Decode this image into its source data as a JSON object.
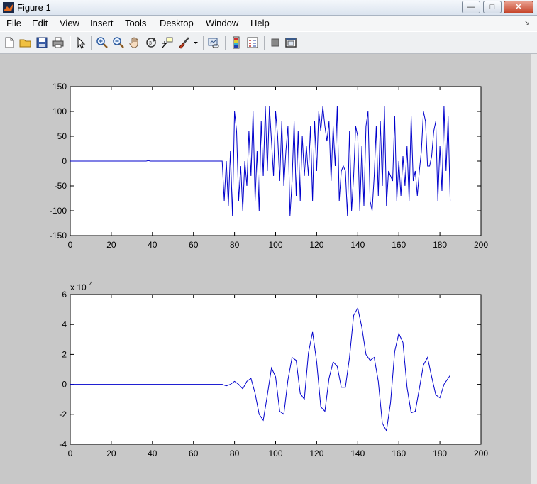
{
  "window": {
    "title": "Figure 1",
    "controls": [
      "minimize",
      "maximize",
      "close"
    ]
  },
  "menu": {
    "items": [
      "File",
      "Edit",
      "View",
      "Insert",
      "Tools",
      "Desktop",
      "Window",
      "Help"
    ]
  },
  "toolbar": {
    "icons": [
      "new-figure-icon",
      "open-file-icon",
      "save-icon",
      "print-icon",
      "pointer-icon",
      "zoom-in-icon",
      "zoom-out-icon",
      "pan-hand-icon",
      "rotate-3d-icon",
      "data-cursor-icon",
      "brush-icon",
      "brush-dropdown-icon",
      "link-plot-icon",
      "colorbar-icon",
      "legend-icon",
      "hide-plot-tools-icon",
      "show-plot-tools-icon"
    ]
  },
  "colors": {
    "line": "#0000cc",
    "axes_bg": "#ffffff",
    "figure_bg": "#c8c8c8"
  },
  "chart_data": [
    {
      "type": "line",
      "title": "",
      "xlabel": "",
      "ylabel": "",
      "xlim": [
        0,
        200
      ],
      "ylim": [
        -150,
        150
      ],
      "xticks": [
        0,
        20,
        40,
        60,
        80,
        100,
        120,
        140,
        160,
        180,
        200
      ],
      "yticks": [
        -150,
        -100,
        -50,
        0,
        50,
        100,
        150
      ],
      "grid": false,
      "series": [
        {
          "x": [
            0,
            10,
            20,
            30,
            37,
            38,
            39,
            40,
            50,
            60,
            70,
            74,
            75,
            76,
            77,
            78,
            79,
            80,
            81,
            82,
            83,
            84,
            85,
            86,
            87,
            88,
            89,
            90,
            91,
            92,
            93,
            94,
            95,
            96,
            97,
            98,
            99,
            100,
            101,
            102,
            103,
            104,
            105,
            106,
            107,
            108,
            109,
            110,
            111,
            112,
            113,
            114,
            115,
            116,
            117,
            118,
            119,
            120,
            121,
            122,
            123,
            124,
            125,
            126,
            127,
            128,
            129,
            130,
            131,
            132,
            133,
            134,
            135,
            136,
            137,
            138,
            139,
            140,
            141,
            142,
            143,
            144,
            145,
            146,
            147,
            148,
            149,
            150,
            151,
            152,
            153,
            154,
            155,
            156,
            157,
            158,
            159,
            160,
            161,
            162,
            163,
            164,
            165,
            166,
            167,
            168,
            169,
            170,
            171,
            172,
            173,
            174,
            175,
            176,
            177,
            178,
            179,
            180,
            181,
            182,
            183,
            184,
            185
          ],
          "y": [
            0,
            0,
            0,
            0,
            0,
            1,
            0,
            0,
            0,
            0,
            0,
            0,
            -80,
            0,
            -90,
            20,
            -110,
            100,
            60,
            -80,
            -10,
            -100,
            0,
            -50,
            60,
            -30,
            100,
            -80,
            20,
            -100,
            80,
            -30,
            110,
            -20,
            110,
            40,
            -30,
            100,
            50,
            -40,
            80,
            -50,
            20,
            70,
            -110,
            -40,
            80,
            -70,
            60,
            -80,
            50,
            -30,
            30,
            -30,
            70,
            -80,
            80,
            -20,
            100,
            60,
            110,
            70,
            40,
            80,
            -40,
            70,
            -10,
            110,
            -80,
            -20,
            -10,
            -20,
            -110,
            60,
            -100,
            -30,
            70,
            50,
            -100,
            30,
            -90,
            70,
            100,
            -80,
            -100,
            -30,
            70,
            -70,
            80,
            -50,
            110,
            -90,
            -20,
            -30,
            -40,
            90,
            -80,
            0,
            -70,
            10,
            -50,
            30,
            -80,
            90,
            -40,
            -20,
            -70,
            -20,
            20,
            100,
            80,
            -10,
            -10,
            10,
            60,
            80,
            -80,
            30,
            -60,
            110,
            -20,
            90,
            -80
          ],
          "color": "#0000cc"
        }
      ]
    },
    {
      "type": "line",
      "title": "",
      "xlabel": "",
      "ylabel": "",
      "exponent_label": "x 10",
      "exponent_power": "4",
      "xlim": [
        0,
        200
      ],
      "ylim": [
        -4,
        6
      ],
      "xticks": [
        0,
        20,
        40,
        60,
        80,
        100,
        120,
        140,
        160,
        180,
        200
      ],
      "yticks": [
        -4,
        -2,
        0,
        2,
        4,
        6
      ],
      "grid": false,
      "series": [
        {
          "x": [
            0,
            10,
            20,
            30,
            40,
            50,
            60,
            70,
            74,
            76,
            78,
            80,
            82,
            84,
            86,
            88,
            90,
            92,
            94,
            96,
            98,
            100,
            102,
            104,
            106,
            108,
            110,
            112,
            114,
            116,
            118,
            120,
            122,
            124,
            126,
            128,
            130,
            132,
            134,
            136,
            138,
            140,
            142,
            144,
            146,
            148,
            150,
            152,
            154,
            156,
            158,
            160,
            162,
            164,
            166,
            168,
            170,
            172,
            174,
            176,
            178,
            180,
            182,
            185
          ],
          "y": [
            0,
            0,
            0,
            0,
            0,
            0,
            0,
            0,
            0,
            -0.1,
            0,
            0.2,
            0,
            -0.3,
            0.2,
            0.4,
            -0.6,
            -2,
            -2.4,
            -0.7,
            1.1,
            0.5,
            -1.8,
            -2.0,
            0.3,
            1.8,
            1.6,
            -0.6,
            -1.0,
            2.1,
            3.5,
            1.5,
            -1.5,
            -1.8,
            0.4,
            1.5,
            1.2,
            -0.2,
            -0.2,
            1.8,
            4.6,
            5.1,
            3.8,
            2,
            1.6,
            1.8,
            0.2,
            -2.6,
            -3.1,
            -1.2,
            2.2,
            3.4,
            2.8,
            -0.2,
            -1.9,
            -1.8,
            -0.3,
            1.3,
            1.8,
            0.5,
            -0.7,
            -0.9,
            0,
            0.6
          ],
          "color": "#0000cc"
        }
      ]
    }
  ]
}
